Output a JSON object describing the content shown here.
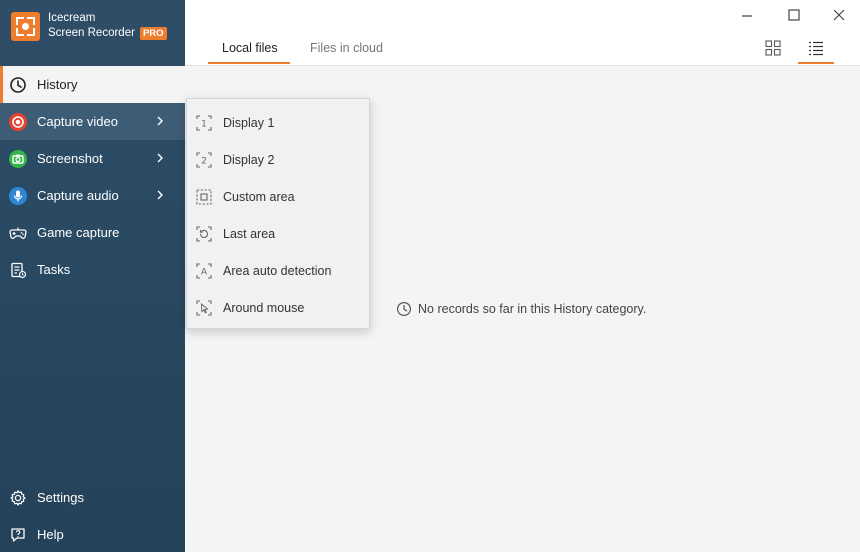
{
  "app": {
    "name_line1": "Icecream",
    "name_line2": "Screen Recorder",
    "badge": "PRO",
    "accent_color": "#ef7d2e"
  },
  "window_controls": [
    {
      "icon": "minimize-icon"
    },
    {
      "icon": "maximize-icon"
    },
    {
      "icon": "close-icon"
    }
  ],
  "sidebar": {
    "items": [
      {
        "label": "History",
        "icon": "clock-icon",
        "active": true
      },
      {
        "label": "Capture video",
        "icon": "record-icon",
        "has_submenu": true,
        "hovered": true
      },
      {
        "label": "Screenshot",
        "icon": "camera-icon",
        "has_submenu": true
      },
      {
        "label": "Capture audio",
        "icon": "microphone-icon",
        "has_submenu": true
      },
      {
        "label": "Game capture",
        "icon": "gamepad-icon"
      },
      {
        "label": "Tasks",
        "icon": "tasks-icon"
      }
    ],
    "bottom_items": [
      {
        "label": "Settings",
        "icon": "gear-icon"
      },
      {
        "label": "Help",
        "icon": "help-icon"
      }
    ]
  },
  "tabs": [
    {
      "label": "Local files",
      "active": true
    },
    {
      "label": "Files in cloud",
      "active": false
    }
  ],
  "view_modes": [
    {
      "icon": "grid-view-icon",
      "active": false
    },
    {
      "icon": "list-view-icon",
      "active": true
    }
  ],
  "empty_state": {
    "message": "No records so far in this History category."
  },
  "capture_video_menu": [
    {
      "label": "Display 1",
      "icon": "display-1-icon"
    },
    {
      "label": "Display 2",
      "icon": "display-2-icon"
    },
    {
      "label": "Custom area",
      "icon": "custom-area-icon"
    },
    {
      "label": "Last area",
      "icon": "last-area-icon"
    },
    {
      "label": "Area auto detection",
      "icon": "area-auto-detection-icon"
    },
    {
      "label": "Around mouse",
      "icon": "around-mouse-icon"
    }
  ]
}
